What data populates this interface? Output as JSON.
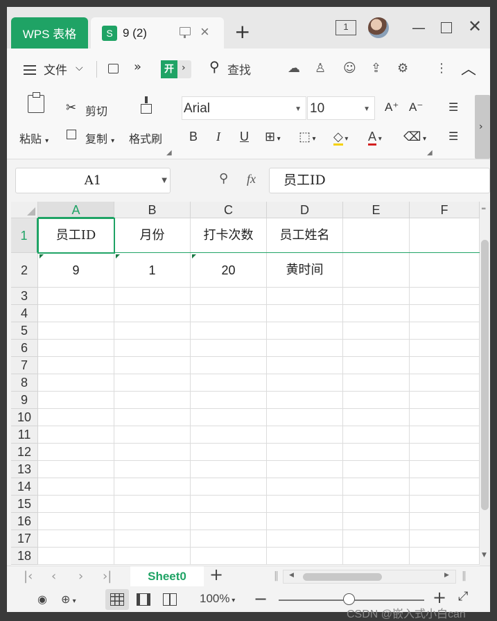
{
  "titlebar": {
    "wps_tab": "WPS 表格",
    "doc_badge": "S",
    "doc_tab": "9 (2)",
    "new_tab": "+",
    "counter": "1"
  },
  "menubar": {
    "file": "文件",
    "start_tab": "开始",
    "search": "查找"
  },
  "ribbon": {
    "paste": "粘贴",
    "cut": "剪切",
    "copy": "复制",
    "format_painter": "格式刷",
    "font": "Arial",
    "font_size": "10",
    "bold": "B",
    "italic": "I",
    "underline": "U",
    "grow_font": "A⁺",
    "shrink_font": "A⁻"
  },
  "formula_bar": {
    "cell_ref": "A1",
    "fx": "fx",
    "value": "员工ID"
  },
  "columns": [
    "A",
    "B",
    "C",
    "D",
    "E",
    "F"
  ],
  "rows": [
    "1",
    "2",
    "3",
    "4",
    "5",
    "6",
    "7",
    "8",
    "9",
    "10",
    "11",
    "12",
    "13",
    "14",
    "15",
    "16",
    "17",
    "18"
  ],
  "cells": {
    "r1": [
      "员工ID",
      "月份",
      "打卡次数",
      "员工姓名",
      "",
      ""
    ],
    "r2": [
      "9",
      "1",
      "20",
      "黄时间",
      "",
      ""
    ]
  },
  "sheets": {
    "active": "Sheet0",
    "add": "+"
  },
  "status": {
    "zoom": "100%",
    "watermark": "CSDN @嵌入式小白can"
  },
  "colors": {
    "accent": "#1fa365"
  }
}
